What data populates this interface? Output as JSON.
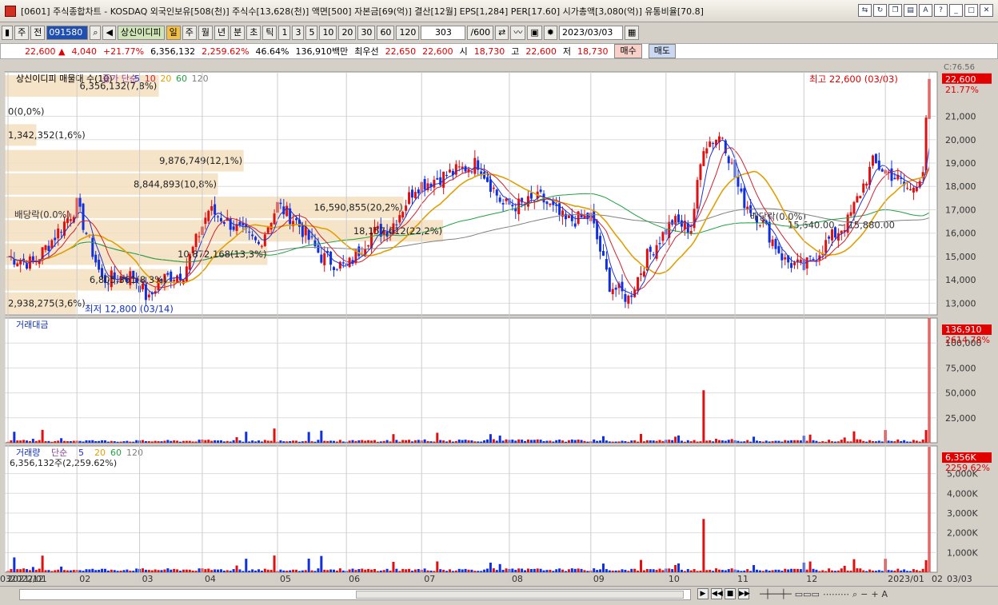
{
  "window": {
    "title": "[0601] 주식종합차트 - KOSDAQ 외국인보유[508(천)] 주식수[13,628(천)] 액면[500] 자본금[69(억)] 결산[12월] EPS[1,284] PER[17.60] 시가총액[3,080(억)] 유통비율[70.8]"
  },
  "toolbar": {
    "mode": "주",
    "period_type": "전",
    "code": "091580",
    "stock_name": "상신이디피",
    "periods": [
      "일",
      "주",
      "월",
      "년",
      "분",
      "초",
      "틱"
    ],
    "active_period": "일",
    "nums": [
      "1",
      "3",
      "5",
      "10",
      "20",
      "30",
      "60",
      "120"
    ],
    "count": "303",
    "count_max": "/600",
    "date": "2023/03/03"
  },
  "quote": {
    "price": "22,600 ▲",
    "change": "4,040",
    "pct": "+21.77%",
    "volume": "6,356,132",
    "vol_ratio": "2,259.62%",
    "rate": "46.64%",
    "amount": "136,910백만",
    "best_label": "최우선",
    "best_ask": "22,650",
    "best_bid": "22,600",
    "open_label": "시",
    "open": "18,730",
    "high_label": "고",
    "high": "22,600",
    "low_label": "저",
    "low": "18,730",
    "buy": "매수",
    "sell": "매도"
  },
  "price_panel": {
    "header": [
      "상신이디피 매물대 수(10)",
      "종가 단순",
      "5",
      "10",
      "20",
      "60",
      "120"
    ],
    "ma_colors": {
      "ma5": "#2030d0",
      "ma10": "#d02030",
      "ma20": "#e0a000",
      "ma60": "#20a040",
      "ma120": "#808080"
    },
    "corner_label": "C:76.56",
    "last_price_tag": "22,600",
    "last_pct_tag": "21.77%",
    "high_note": "최고 22,600 (03/03)",
    "low_note": "최저 12,800 (03/14)",
    "dividend_labels": [
      "배당락(0.0%)",
      "배당락(0.0%)"
    ],
    "gap_label": "15,640.00 ~ 15,880.00",
    "y_ticks": [
      "21,000",
      "20,000",
      "19,000",
      "18,000",
      "17,000",
      "16,000",
      "15,000",
      "14,000",
      "13,000"
    ],
    "volume_profile": [
      {
        "label": "6,356,132(7,8%)",
        "price": 22300,
        "width_pct": 7.8
      },
      {
        "label": "0(0,0%)",
        "price": 21200,
        "width_pct": 0
      },
      {
        "label": "1,342,352(1,6%)",
        "price": 20200,
        "width_pct": 1.6
      },
      {
        "label": "9,876,749(12,1%)",
        "price": 19100,
        "width_pct": 12.1
      },
      {
        "label": "8,844,893(10,8%)",
        "price": 18100,
        "width_pct": 10.8
      },
      {
        "label": "16,590,855(20,2%)",
        "price": 17100,
        "width_pct": 20.2
      },
      {
        "label": "18,157,612(22,2%)",
        "price": 16100,
        "width_pct": 22.2
      },
      {
        "label": "10,872,168(13,3%)",
        "price": 15100,
        "width_pct": 13.3
      },
      {
        "label": "6,805,361(8,3%)",
        "price": 14000,
        "width_pct": 8.3
      },
      {
        "label": "2,938,275(3,6%)",
        "price": 13000,
        "width_pct": 3.6
      }
    ]
  },
  "amount_panel": {
    "title": "거래대금",
    "tag": "136,910",
    "tag_pct": "2614.78%",
    "y_ticks": [
      "100,000",
      "75,000",
      "50,000",
      "25,000"
    ]
  },
  "volume_panel": {
    "title": "거래량",
    "ma_label": "단순",
    "ma_nums": [
      "5",
      "20",
      "60",
      "120"
    ],
    "info": "6,356,132주(2,259.62%)",
    "tag": "6,356K",
    "tag_pct": "2259.62%",
    "y_ticks": [
      "5,000K",
      "4,000K",
      "3,000K",
      "2,000K",
      "1,000K"
    ]
  },
  "x_axis": [
    "2021/12",
    "2022/01",
    "02",
    "03",
    "04",
    "05",
    "06",
    "07",
    "08",
    "09",
    "10",
    "11",
    "12",
    "2023/01",
    "02",
    "03"
  ],
  "x_axis_right": "03/03",
  "chart_data": {
    "type": "candlestick",
    "last_close": 22600,
    "high": 22600,
    "low": 12800,
    "ylim": [
      12500,
      22900
    ],
    "amount_ylim": [
      0,
      125000
    ],
    "volume_ylim": [
      0,
      6400000
    ],
    "anchors": [
      [
        0,
        15000
      ],
      [
        8,
        14700
      ],
      [
        14,
        15700
      ],
      [
        22,
        17200
      ],
      [
        30,
        14000
      ],
      [
        40,
        14200
      ],
      [
        45,
        13100
      ],
      [
        48,
        14000
      ],
      [
        56,
        14300
      ],
      [
        64,
        17000
      ],
      [
        70,
        16500
      ],
      [
        80,
        15500
      ],
      [
        86,
        17200
      ],
      [
        92,
        16500
      ],
      [
        100,
        15000
      ],
      [
        108,
        14500
      ],
      [
        116,
        16000
      ],
      [
        122,
        16200
      ],
      [
        130,
        18000
      ],
      [
        140,
        18500
      ],
      [
        150,
        19000
      ],
      [
        158,
        17200
      ],
      [
        164,
        17200
      ],
      [
        170,
        17500
      ],
      [
        178,
        16500
      ],
      [
        186,
        16700
      ],
      [
        192,
        13800
      ],
      [
        198,
        13200
      ],
      [
        204,
        15000
      ],
      [
        212,
        16500
      ],
      [
        218,
        16200
      ],
      [
        222,
        19800
      ],
      [
        228,
        20200
      ],
      [
        234,
        17500
      ],
      [
        240,
        16600
      ],
      [
        248,
        14800
      ],
      [
        254,
        14500
      ],
      [
        262,
        15700
      ],
      [
        268,
        16500
      ],
      [
        276,
        19000
      ],
      [
        282,
        18500
      ],
      [
        288,
        17800
      ],
      [
        292,
        18700
      ],
      [
        294,
        22600
      ]
    ]
  }
}
